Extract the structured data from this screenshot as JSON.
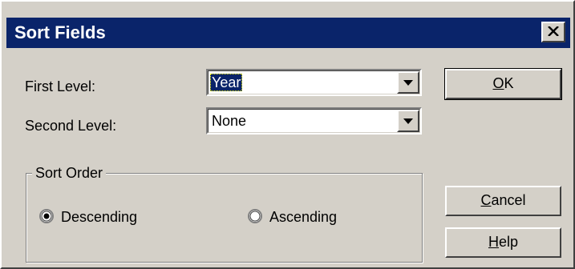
{
  "dialog": {
    "title": "Sort Fields"
  },
  "fields": {
    "first_level_label": "First Level:",
    "first_level_value": "Year",
    "second_level_label": "Second Level:",
    "second_level_value": "None"
  },
  "sort_order": {
    "legend": "Sort Order",
    "options": [
      {
        "label": "Descending",
        "selected": true
      },
      {
        "label": "Ascending",
        "selected": false
      }
    ]
  },
  "buttons": {
    "ok": {
      "mnemonic": "O",
      "rest": "K"
    },
    "cancel": {
      "mnemonic": "C",
      "rest": "ancel"
    },
    "help": {
      "mnemonic": "H",
      "rest": "elp"
    }
  },
  "icons": {
    "close": "close-icon",
    "dropdown": "chevron-down-icon"
  },
  "colors": {
    "titlebar": "#0a246a",
    "face": "#d4d0c8",
    "selection": "#0a246a"
  }
}
